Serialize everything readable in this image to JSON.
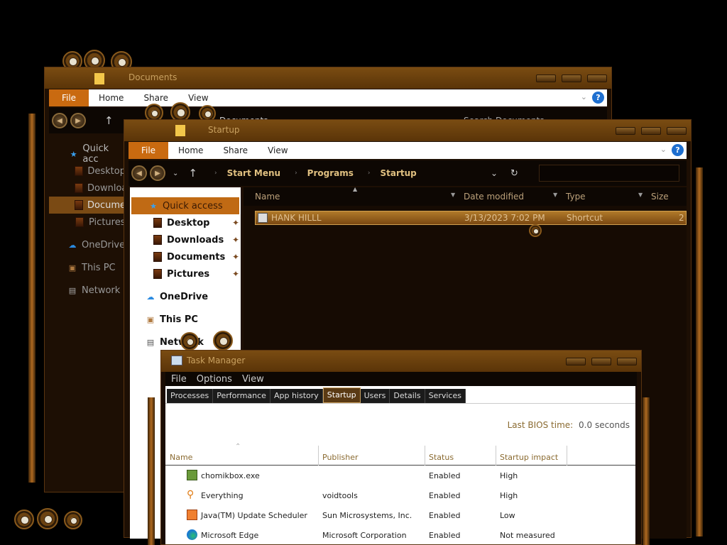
{
  "back_window": {
    "title": "Documents",
    "ribbon": {
      "file": "File",
      "tabs": [
        "Home",
        "Share",
        "View"
      ]
    },
    "address": "Documents",
    "search_placeholder": "Search Documents",
    "nav": [
      {
        "label": "Quick acc",
        "icon": "star-icon"
      },
      {
        "label": "Desktop",
        "icon": "folder-icon"
      },
      {
        "label": "Downloads",
        "icon": "folder-icon"
      },
      {
        "label": "Documents",
        "icon": "folder-icon",
        "selected": true
      },
      {
        "label": "Pictures",
        "icon": "folder-icon"
      },
      {
        "label": "OneDrive",
        "icon": "cloud-icon"
      },
      {
        "label": "This PC",
        "icon": "computer-icon"
      },
      {
        "label": "Network",
        "icon": "network-icon"
      }
    ]
  },
  "startup_window": {
    "title": "Startup",
    "ribbon": {
      "file": "File",
      "tabs": [
        "Home",
        "Share",
        "View"
      ]
    },
    "breadcrumb": [
      "Start Menu",
      "Programs",
      "Startup"
    ],
    "columns": [
      "Name",
      "Date modified",
      "Type",
      "Size"
    ],
    "files": [
      {
        "name": "HANK HILLL",
        "date": "3/13/2023 7:02 PM",
        "type": "Shortcut",
        "size": "2"
      }
    ],
    "nav": [
      {
        "label": "Quick access",
        "icon": "star-icon",
        "selected": true
      },
      {
        "label": "Desktop",
        "icon": "folder-icon",
        "pinned": true
      },
      {
        "label": "Downloads",
        "icon": "folder-icon",
        "pinned": true
      },
      {
        "label": "Documents",
        "icon": "folder-icon",
        "pinned": true
      },
      {
        "label": "Pictures",
        "icon": "folder-icon",
        "pinned": true
      },
      {
        "label": "OneDrive",
        "icon": "cloud-icon"
      },
      {
        "label": "This PC",
        "icon": "computer-icon"
      },
      {
        "label": "Network",
        "icon": "network-icon"
      }
    ]
  },
  "task_manager": {
    "title": "Task Manager",
    "menu": [
      "File",
      "Options",
      "View"
    ],
    "tabs": [
      "Processes",
      "Performance",
      "App history",
      "Startup",
      "Users",
      "Details",
      "Services"
    ],
    "active_tab": "Startup",
    "bios_label": "Last BIOS time:",
    "bios_value": "0.0 seconds",
    "columns": [
      "Name",
      "Publisher",
      "Status",
      "Startup impact"
    ],
    "rows": [
      {
        "name": "chomikbox.exe",
        "publisher": "",
        "status": "Enabled",
        "impact": "High",
        "icon_color": "#6a9a3a"
      },
      {
        "name": "Everything",
        "publisher": "voidtools",
        "status": "Enabled",
        "impact": "High",
        "icon_color": "#e07a10"
      },
      {
        "name": "Java(TM) Update Scheduler",
        "publisher": "Sun Microsystems, Inc.",
        "status": "Enabled",
        "impact": "Low",
        "icon_color": "#e05a10"
      },
      {
        "name": "Microsoft Edge",
        "publisher": "Microsoft Corporation",
        "status": "Enabled",
        "impact": "Not measured",
        "icon_color": "#1a8ad0"
      }
    ]
  },
  "colors": {
    "accent": "#c96a10",
    "frame": "#5a3408",
    "selection": "#8a5418"
  }
}
